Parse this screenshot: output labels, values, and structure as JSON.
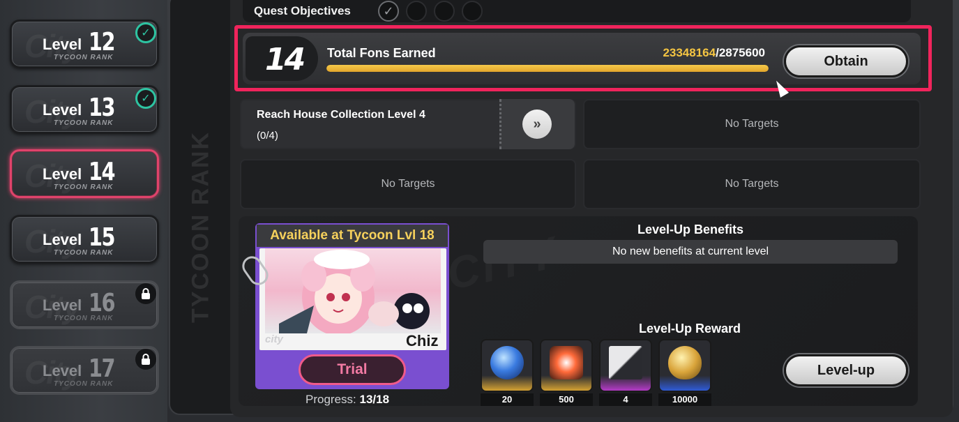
{
  "levels": [
    {
      "word": "Level",
      "num": "12",
      "rank": "TYCOON RANK",
      "status": "completed"
    },
    {
      "word": "Level",
      "num": "13",
      "rank": "TYCOON RANK",
      "status": "completed"
    },
    {
      "word": "Level",
      "num": "14",
      "rank": "TYCOON RANK",
      "status": "active"
    },
    {
      "word": "Level",
      "num": "15",
      "rank": "TYCOON RANK",
      "status": "open"
    },
    {
      "word": "Level",
      "num": "16",
      "rank": "TYCOON RANK",
      "status": "locked"
    },
    {
      "word": "Level",
      "num": "17",
      "rank": "TYCOON RANK",
      "status": "locked"
    }
  ],
  "side_label": "TYCOON RANK",
  "objectives": {
    "title": "Quest Objectives",
    "completed_count": 1,
    "total_count": 4
  },
  "fons": {
    "level": "14",
    "title": "Total Fons Earned",
    "current": "23348164",
    "separator": "/",
    "target": "2875600",
    "progress_fraction": 1.0,
    "button": "Obtain",
    "highlight_color": "#f0245c"
  },
  "targets": [
    {
      "text": "Reach House Collection Level 4",
      "count": "(0/4)"
    },
    {
      "text": "No Targets"
    },
    {
      "text": "No Targets"
    },
    {
      "text": "No Targets"
    }
  ],
  "character": {
    "header": "Available at Tycoon Lvl 18",
    "name": "Chiz",
    "logo": "city",
    "trial_button": "Trial",
    "progress_label": "Progress:",
    "progress_value": "13/18"
  },
  "benefits": {
    "title": "Level-Up Benefits",
    "text": "No new benefits at current level"
  },
  "reward": {
    "title": "Level-Up Reward",
    "items": [
      {
        "icon": "blue-orb-icon",
        "count": "20",
        "rarity": "gold"
      },
      {
        "icon": "hunter-badge-icon",
        "count": "500",
        "rarity": "gold"
      },
      {
        "icon": "card-pack-icon",
        "count": "4",
        "rarity": "purple"
      },
      {
        "icon": "golden-egg-icon",
        "count": "10000",
        "rarity": "blue"
      }
    ],
    "button": "Level-up"
  },
  "colors": {
    "accent_gold": "#f5c542",
    "check_teal": "#2ec4a2",
    "active_pink": "#e0436b"
  }
}
